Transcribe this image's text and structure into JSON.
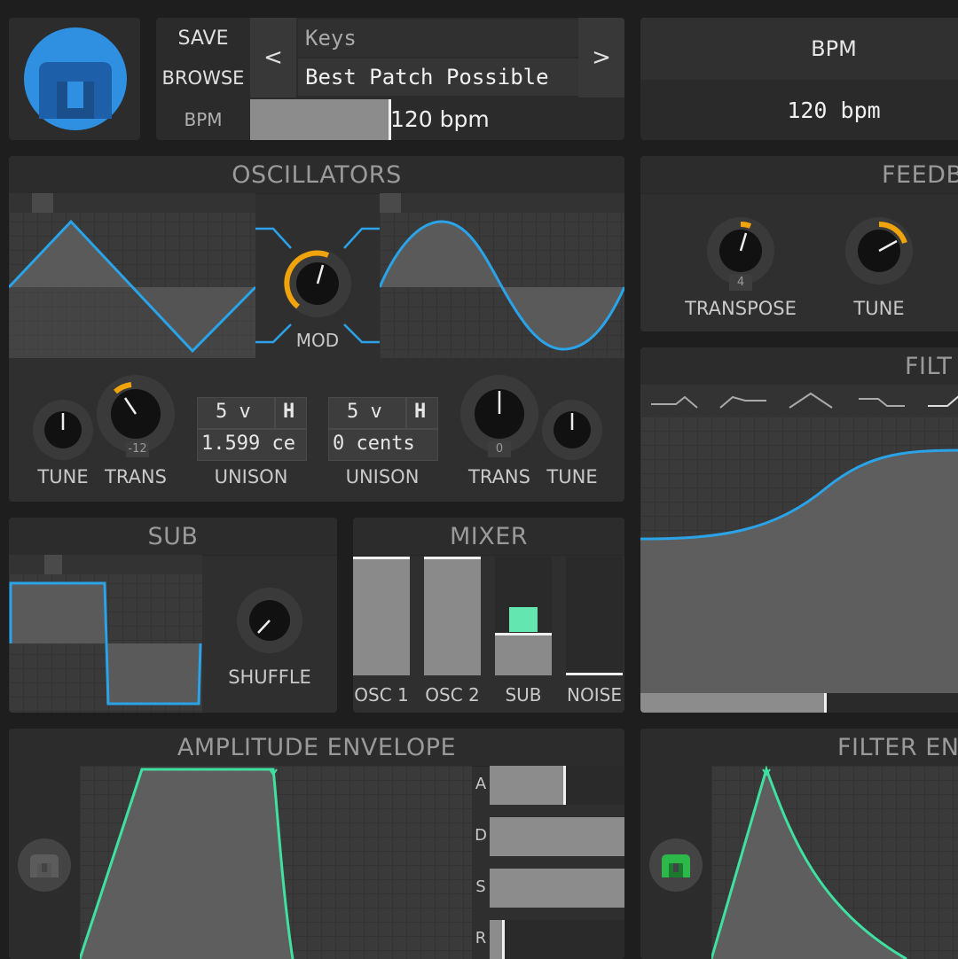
{
  "header": {
    "save_label": "SAVE",
    "browse_label": "BROWSE",
    "prev_arrow": "<",
    "next_arrow": ">",
    "patch_folder": "Keys",
    "patch_name": "Best Patch Possible",
    "bpm_label": "BPM",
    "bpm_value": "120 bpm",
    "bpm_slider_fraction": 0.3
  },
  "bpm_panel": {
    "title": "BPM",
    "value": "120 bpm"
  },
  "oscillators": {
    "title": "OSCILLATORS",
    "mod_label": "MOD",
    "osc1": {
      "waveform": "triangle",
      "tune_label": "TUNE",
      "trans_label": "TRANS",
      "trans_value": "-12",
      "unison_voices": "5 v",
      "unison_h": "H",
      "unison_detune": "1.599 ce",
      "unison_label": "UNISON"
    },
    "osc2": {
      "waveform": "sine",
      "tune_label": "TUNE",
      "trans_label": "TRANS",
      "trans_value": "0",
      "unison_voices": "5 v",
      "unison_h": "H",
      "unison_detune": "0 cents",
      "unison_label": "UNISON"
    }
  },
  "feedback": {
    "title": "FEEDB",
    "transpose_label": "TRANSPOSE",
    "transpose_value": "4",
    "tune_label": "TUNE"
  },
  "filter": {
    "title": "FILT"
  },
  "sub": {
    "title": "SUB",
    "shuffle_label": "SHUFFLE"
  },
  "mixer": {
    "title": "MIXER",
    "channels": [
      {
        "label": "OSC 1",
        "level": 1.0
      },
      {
        "label": "OSC 2",
        "level": 1.0
      },
      {
        "label": "SUB",
        "level": 0.36
      },
      {
        "label": "NOISE",
        "level": 0.0
      }
    ]
  },
  "amp_env": {
    "title": "AMPLITUDE ENVELOPE",
    "sliders": [
      {
        "label": "A",
        "level": 0.5
      },
      {
        "label": "D",
        "level": 1.0
      },
      {
        "label": "S",
        "level": 1.0
      },
      {
        "label": "R",
        "level": 0.1
      }
    ]
  },
  "filter_env": {
    "title": "FILTER EN"
  },
  "colors": {
    "accent_blue": "#2aa3e8",
    "accent_orange": "#f0a30a",
    "accent_green": "#3fe0a0",
    "logo_blue": "#2f8fe0"
  }
}
